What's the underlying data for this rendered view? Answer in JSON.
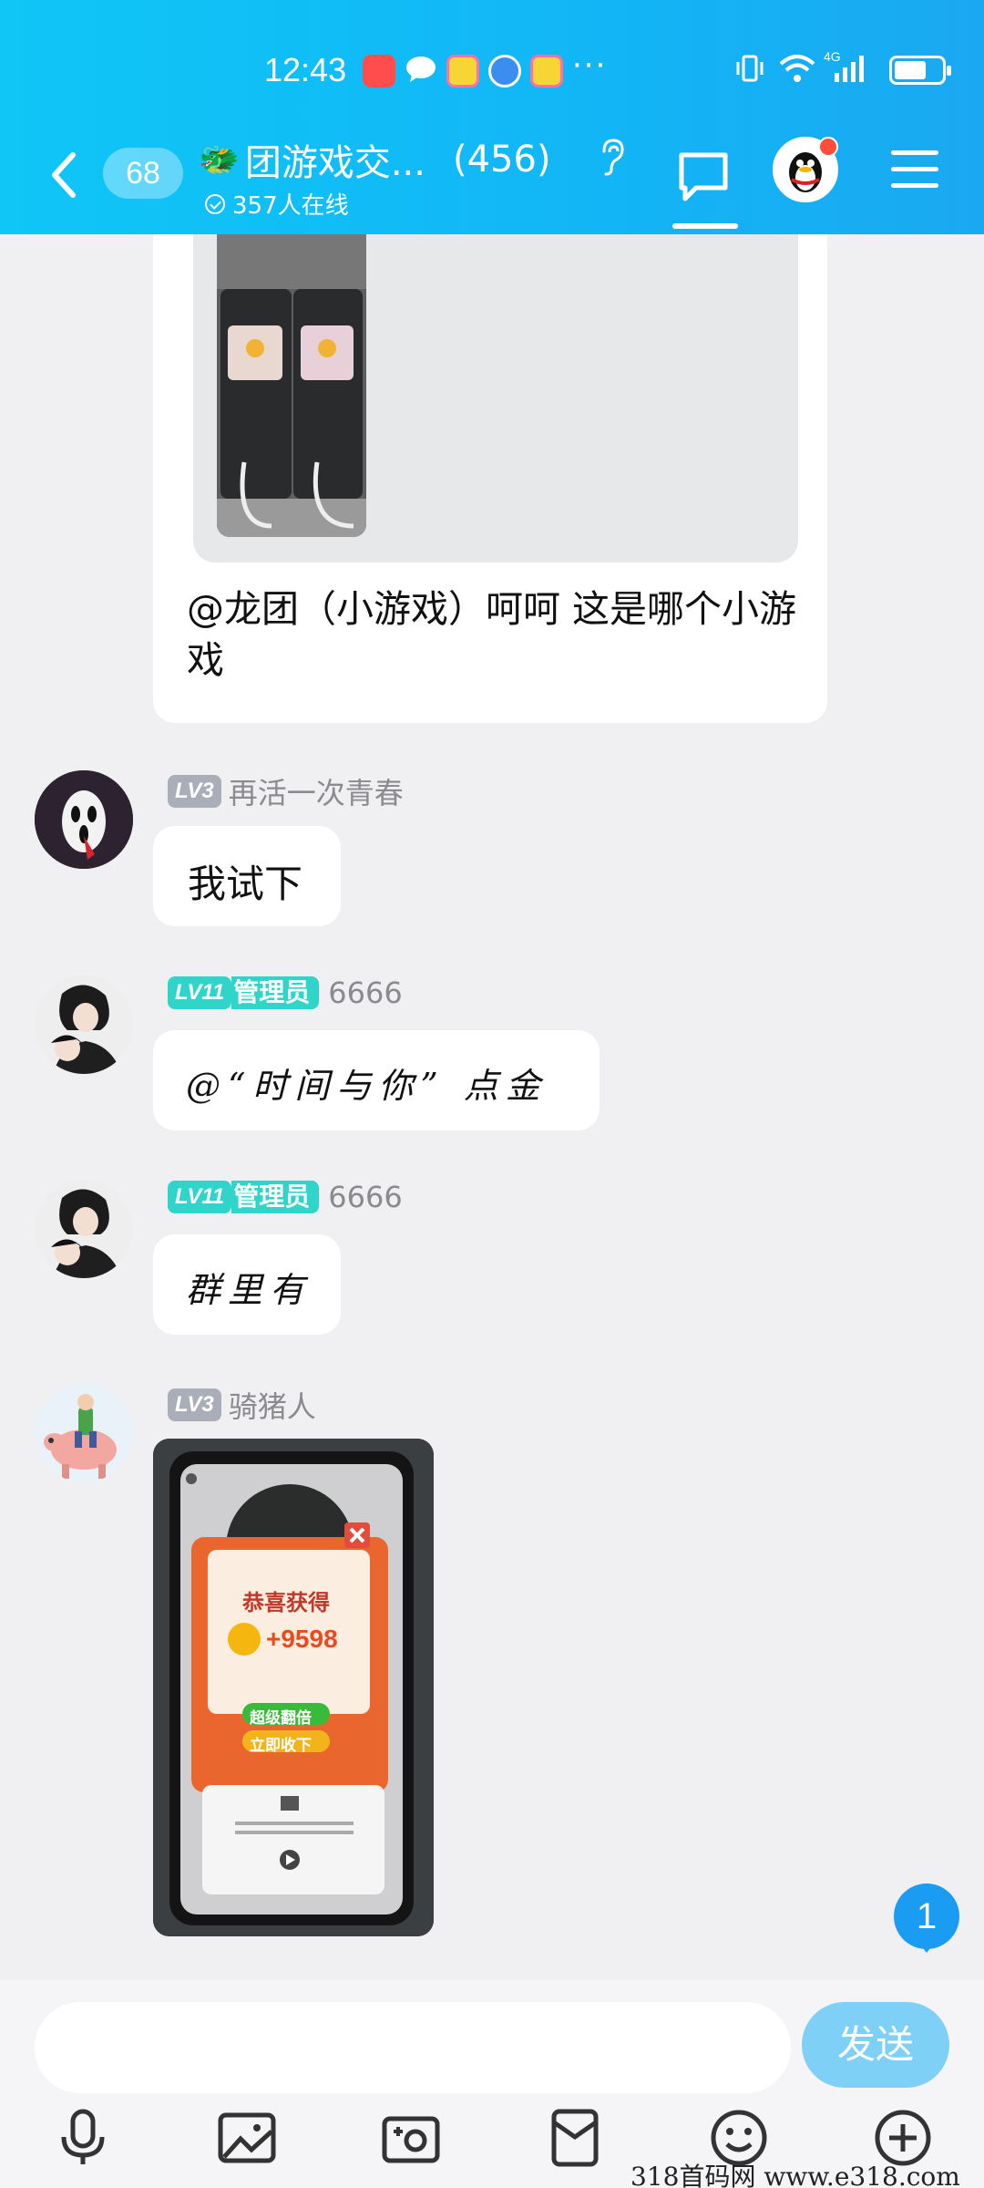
{
  "status_bar": {
    "time": "12:43",
    "dots": "···",
    "network": "4G"
  },
  "header": {
    "unread_count": "68",
    "group_emoji": "🐲",
    "group_name": "团游戏交...",
    "member_count": "(456)",
    "online_text": "357人在线"
  },
  "messages": [
    {
      "id": "msg1",
      "text": "@龙团（小游戏）呵呵 这是哪个小游戏"
    },
    {
      "id": "msg2",
      "level": "LV3",
      "sender": "再活一次青春",
      "text": "我试下"
    },
    {
      "id": "msg3",
      "level": "LV11",
      "role": "管理员",
      "sender": "6666",
      "text": "@“时间与你” 点金"
    },
    {
      "id": "msg4",
      "level": "LV11",
      "role": "管理员",
      "sender": "6666",
      "text": "群里有"
    },
    {
      "id": "msg5",
      "level": "LV3",
      "sender": "骑猪人",
      "photo_texts": {
        "title": "恭喜获得",
        "amount": "+9598",
        "button1": "超级翻倍",
        "button2": "立即收下"
      }
    }
  ],
  "new_message_badge": "1",
  "composer": {
    "placeholder": "",
    "send_label": "发送"
  },
  "toolbar": [
    "voice-icon",
    "picture-icon",
    "camera-icon",
    "red-packet-icon",
    "emoji-icon",
    "plus-icon"
  ],
  "watermark": "318首码网   www.e318.com",
  "colors": {
    "header_start": "#0fc6f7",
    "header_end": "#1aa8f2",
    "admin_teal": "#2fd5c8",
    "send_button": "#7ed0f6",
    "badge_blue": "#1a9cf2"
  }
}
